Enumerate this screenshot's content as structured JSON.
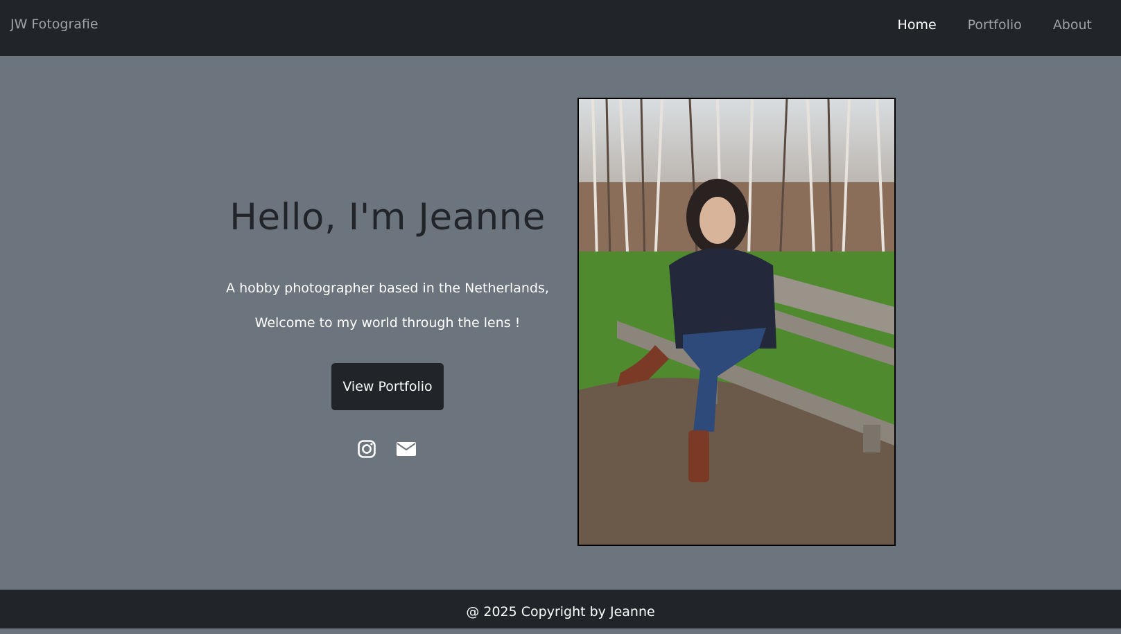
{
  "navbar": {
    "brand": "JW Fotografie",
    "links": [
      {
        "label": "Home",
        "active": true
      },
      {
        "label": "Portfolio",
        "active": false
      },
      {
        "label": "About",
        "active": false
      }
    ]
  },
  "hero": {
    "title": "Hello, I'm Jeanne",
    "line1": "A hobby photographer based in the Netherlands,",
    "line2": "Welcome to my world through the lens !",
    "cta_label": "View Portfolio",
    "icons": [
      "instagram-icon",
      "mail-icon"
    ]
  },
  "footer": {
    "text": "@ 2025 Copyright by Jeanne"
  },
  "colors": {
    "navbar_bg": "#212529",
    "page_bg": "#6c757d",
    "title": "#212529"
  }
}
